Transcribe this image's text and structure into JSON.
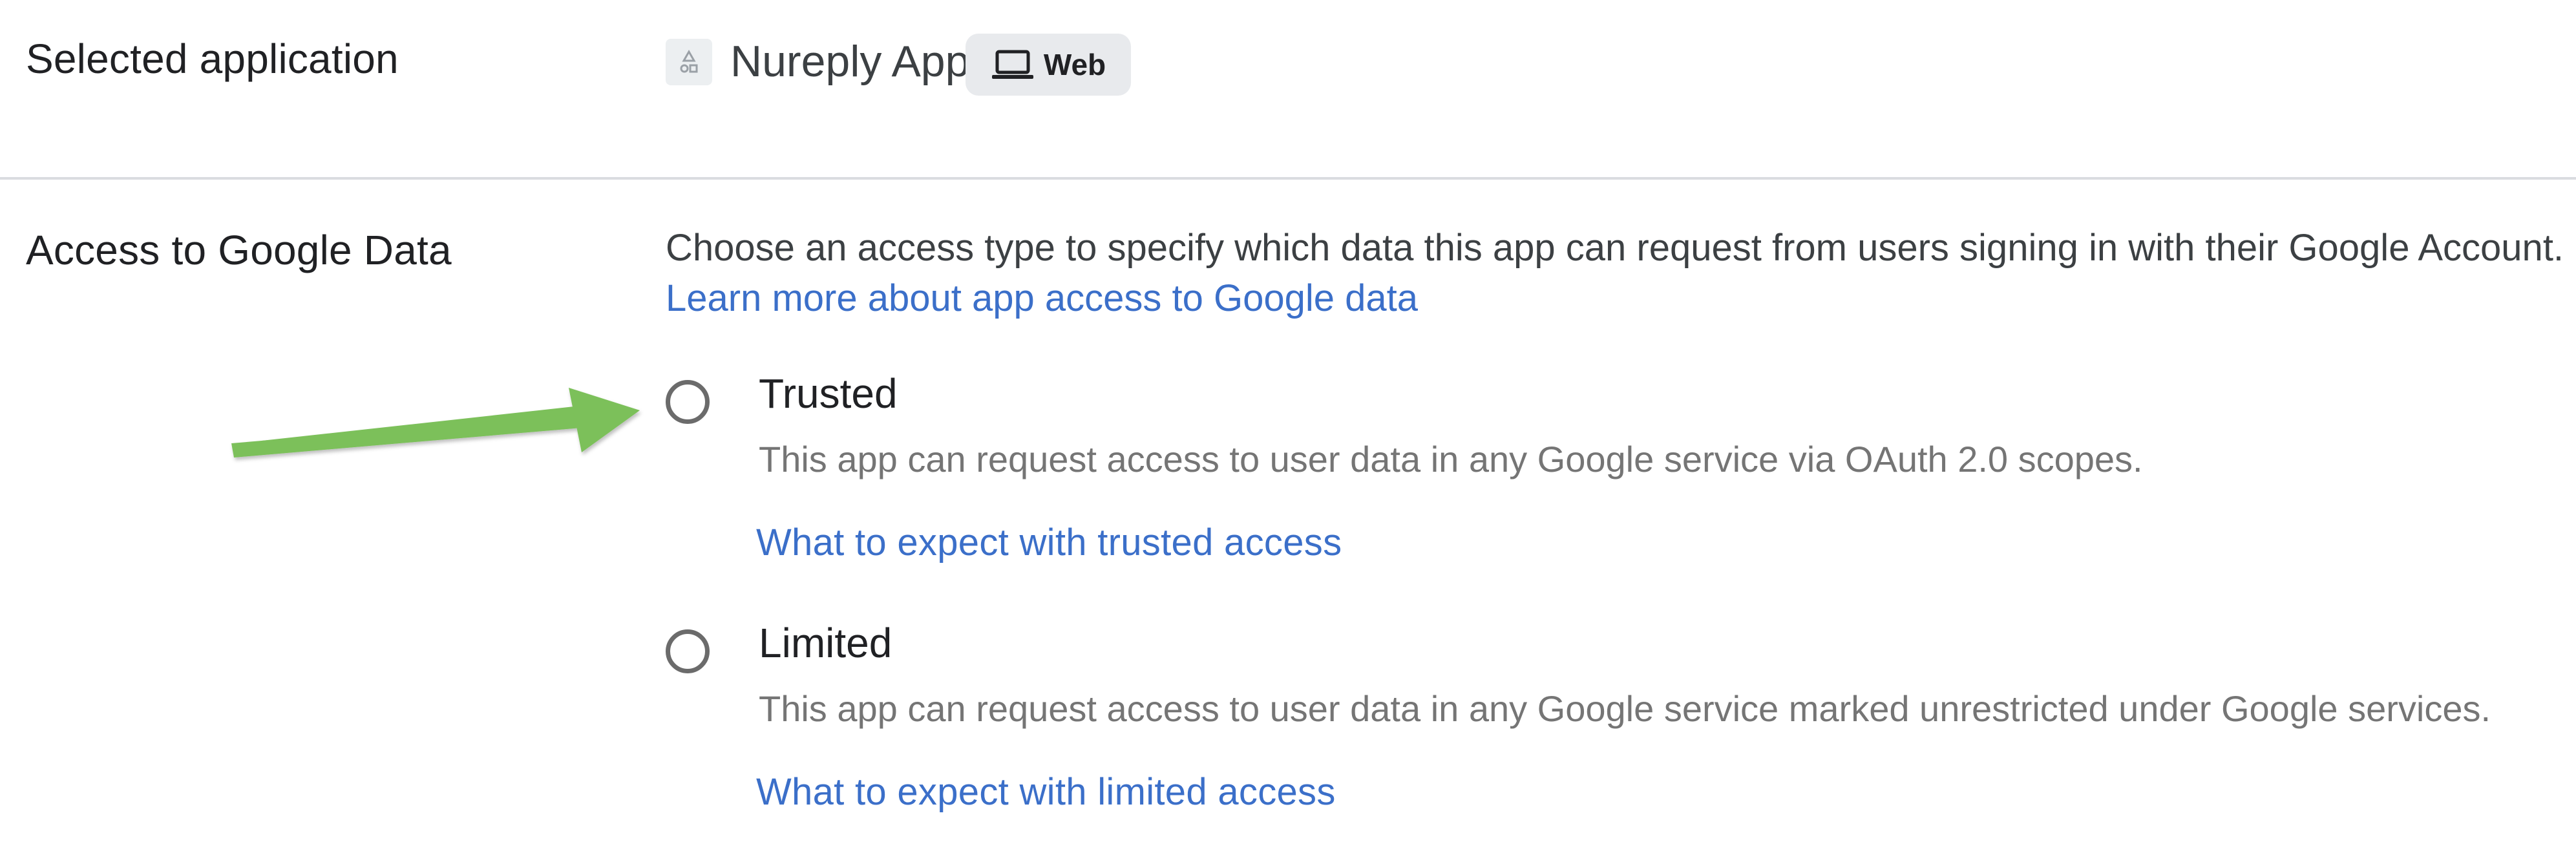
{
  "selected_application": {
    "label": "Selected application",
    "app_icon": "app-placeholder-icon",
    "app_name": "Nureply App",
    "platform": {
      "icon": "laptop-icon",
      "label": "Web"
    }
  },
  "access": {
    "label": "Access to Google Data",
    "description": "Choose an access type to specify which data this app can request from users signing in with their Google Account.",
    "learn_more_link": "Learn more about app access to Google data",
    "options": [
      {
        "title": "Trusted",
        "description": "This app can request access to user data in any Google service via OAuth 2.0 scopes.",
        "link": "What to expect with trusted access",
        "selected": false
      },
      {
        "title": "Limited",
        "description": "This app can request access to user data in any Google service marked unrestricted under Google services.",
        "link": "What to expect with limited access",
        "selected": false
      }
    ]
  },
  "annotation": {
    "arrow_color": "#7cc05a",
    "points_to": "Trusted"
  },
  "colors": {
    "link": "#3b6fc9",
    "divider": "#dadce0",
    "chip_bg": "#e8eaed"
  }
}
